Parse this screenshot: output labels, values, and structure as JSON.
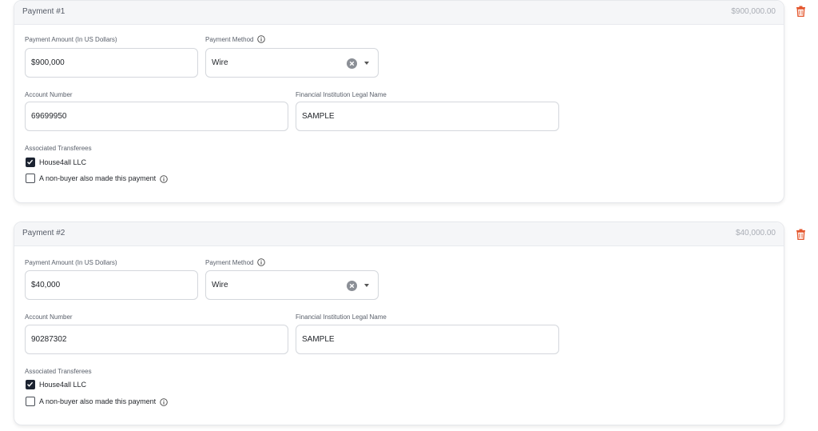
{
  "payments": [
    {
      "title": "Payment #1",
      "total": "$900,000.00",
      "amount_label": "Payment Amount (In US Dollars)",
      "amount_value": "$900,000",
      "method_label": "Payment Method",
      "method_value": "Wire",
      "account_label": "Account Number",
      "account_value": "69699950",
      "institution_label": "Financial Institution Legal Name",
      "institution_value": "SAMPLE",
      "transferees_label": "Associated Transferees",
      "transferee_option": "House4all LLC",
      "transferee_checked": true,
      "nonbuyer_label": "A non-buyer also made this payment",
      "nonbuyer_checked": false
    },
    {
      "title": "Payment #2",
      "total": "$40,000.00",
      "amount_label": "Payment Amount (In US Dollars)",
      "amount_value": "$40,000",
      "method_label": "Payment Method",
      "method_value": "Wire",
      "account_label": "Account Number",
      "account_value": "90287302",
      "institution_label": "Financial Institution Legal Name",
      "institution_value": "SAMPLE",
      "transferees_label": "Associated Transferees",
      "transferee_option": "House4all LLC",
      "transferee_checked": true,
      "nonbuyer_label": "A non-buyer also made this payment",
      "nonbuyer_checked": false
    }
  ],
  "colors": {
    "delete": "#e4572e",
    "checkbox_fill": "#1c2331",
    "header_bg": "#f5f6f8"
  },
  "icons": {
    "delete": "trash-icon",
    "info": "info-icon",
    "clear": "clear-circle-icon",
    "dropdown": "caret-down-icon",
    "check": "check-icon"
  }
}
